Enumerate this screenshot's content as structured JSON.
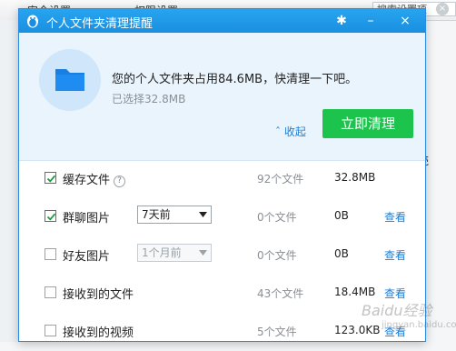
{
  "background": {
    "tabs": [
      "安全设置",
      "权限设置"
    ],
    "search_placeholder": "搜索设置项",
    "side_text": "壳"
  },
  "dialog": {
    "title": "个人文件夹清理提醒",
    "settings_icon": "gear-icon",
    "minimize_label": "–",
    "close_label": "×",
    "headline": "您的个人文件夹占用84.6MB，快清理一下吧。",
    "selected": "已选择32.8MB",
    "collapse_label": "收起",
    "clean_button": "立即清理",
    "accent_color": "#1a8fe0",
    "button_color": "#1cc44e",
    "rows": [
      {
        "label": "缓存文件",
        "help": "?",
        "checked": true,
        "count": "92个文件",
        "size": "32.8MB",
        "view": ""
      },
      {
        "label": "群聊图片",
        "select": "7天前",
        "checked": true,
        "count": "0个文件",
        "size": "0B",
        "view": "查看"
      },
      {
        "label": "好友图片",
        "select": "1个月前",
        "checked": false,
        "disabled": true,
        "count": "0个文件",
        "size": "0B",
        "view": "查看"
      },
      {
        "label": "接收到的文件",
        "checked": false,
        "count": "43个文件",
        "size": "18.4MB",
        "view": "查看"
      },
      {
        "label": "接收到的视频",
        "checked": false,
        "count": "5个文件",
        "size": "123.0KB",
        "view": "查看"
      }
    ]
  },
  "watermark": {
    "main": "Baidu经验",
    "sub": "jingyan.baidu.com"
  }
}
